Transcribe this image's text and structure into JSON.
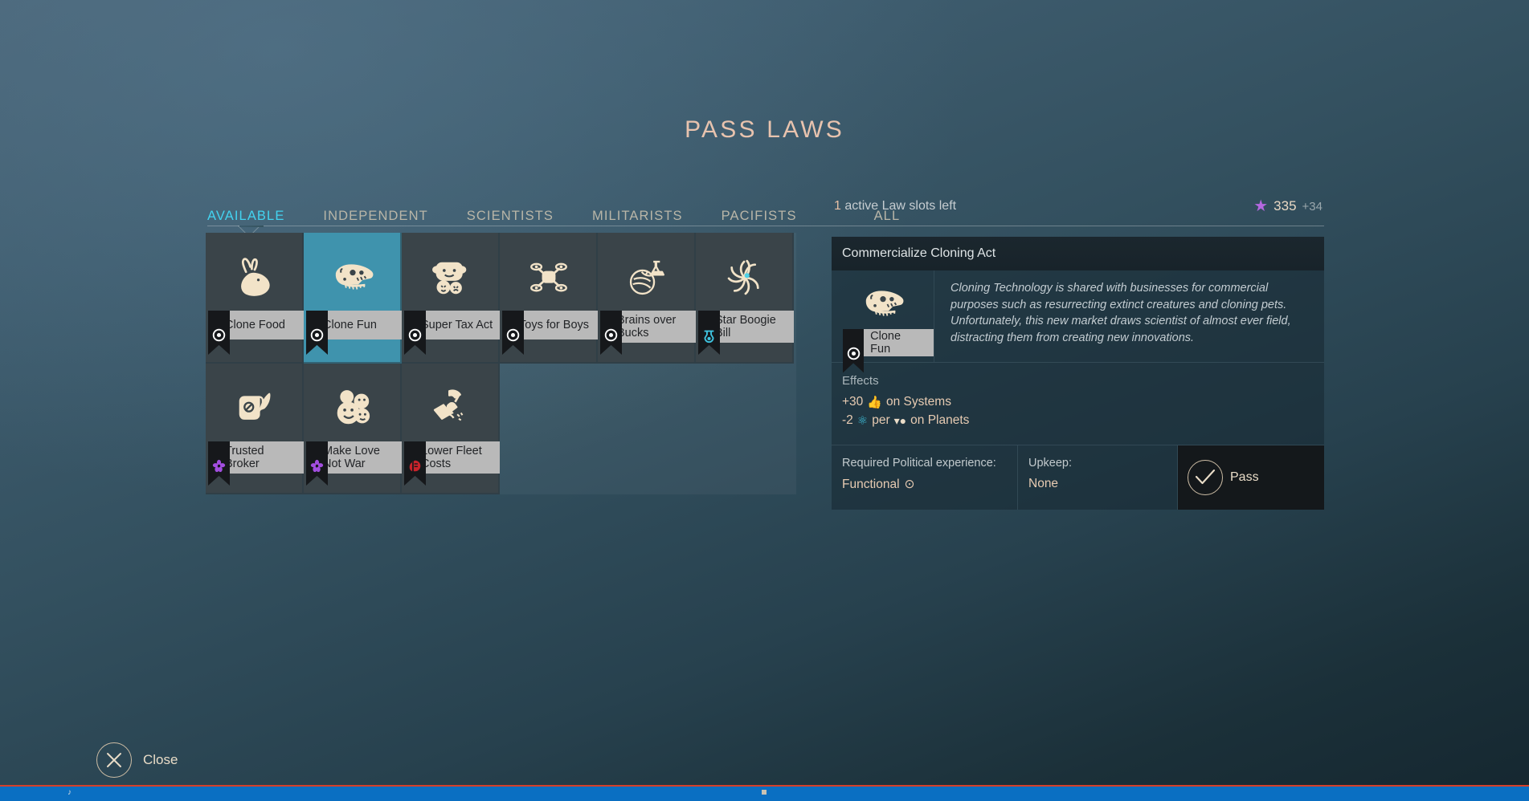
{
  "page_title": "PASS LAWS",
  "tabs": [
    {
      "label": "AVAILABLE",
      "active": true
    },
    {
      "label": "INDEPENDENT",
      "active": false
    },
    {
      "label": "SCIENTISTS",
      "active": false
    },
    {
      "label": "MILITARISTS",
      "active": false
    },
    {
      "label": "PACIFISTS",
      "active": false
    },
    {
      "label": "ALL",
      "active": false,
      "spaced": true
    }
  ],
  "status": {
    "slots_count": "1",
    "slots_text": " active Law slots left",
    "currency_icon": "star-icon",
    "currency_value": "335",
    "currency_delta": "+34",
    "currency_color": "#b468e0"
  },
  "cards": [
    {
      "name": "Clone Food",
      "icon": "rabbit-icon",
      "badge": "eye-badge",
      "badge_color": "#ffffff",
      "selected": false
    },
    {
      "name": "Clone Fun",
      "icon": "dino-skull-icon",
      "badge": "eye-badge",
      "badge_color": "#ffffff",
      "selected": true
    },
    {
      "name": "Super Tax Act",
      "icon": "masks-icon",
      "badge": "eye-badge",
      "badge_color": "#ffffff",
      "selected": false
    },
    {
      "name": "Toys for Boys",
      "icon": "drone-icon",
      "badge": "eye-badge",
      "badge_color": "#ffffff",
      "selected": false
    },
    {
      "name": "Brains over Bucks",
      "icon": "flask-orbit-icon",
      "badge": "eye-badge",
      "badge_color": "#ffffff",
      "selected": false
    },
    {
      "name": "Star Boogie Bill",
      "icon": "spiral-icon",
      "badge": "potion-badge",
      "badge_color": "#3fc4e0",
      "selected": false
    },
    {
      "name": "Trusted Broker",
      "icon": "scroll-quill-icon",
      "badge": "flower-badge",
      "badge_color": "#a34ee0",
      "selected": false
    },
    {
      "name": "Make Love Not War",
      "icon": "smileys-icon",
      "badge": "flower-badge",
      "badge_color": "#a34ee0",
      "selected": false
    },
    {
      "name": "Lower Fleet Costs",
      "icon": "hammer-hand-icon",
      "badge": "helmet-badge",
      "badge_color": "#c8232b",
      "selected": false
    }
  ],
  "detail": {
    "title": "Commercialize Cloning Act",
    "icon": "dino-skull-icon",
    "chip_label": "Clone Fun",
    "chip_badge": "eye-badge",
    "description": "Cloning Technology is shared with businesses for commercial purposes such as resurrecting extinct creatures and cloning pets. Unfortunately, this new market draws scientist of almost ever field, distracting them from creating new innovations.",
    "effects_title": "Effects",
    "effects": [
      {
        "amount": "+30",
        "icon": "approval-thumb-icon",
        "icon_color": "#f06cc0",
        "text": "on Systems"
      },
      {
        "amount": "-2",
        "icon": "research-atom-icon",
        "icon_color": "#3fc4e0",
        "text_pre": "per",
        "icon2": "population-icon",
        "icon2_color": "#eadcc8",
        "text": "on Planets"
      }
    ],
    "requirement_label": "Required Political experience:",
    "requirement_value": "Functional",
    "requirement_icon": "eye-icon",
    "upkeep_label": "Upkeep:",
    "upkeep_value": "None",
    "pass_label": "Pass",
    "pass_icon": "checkmark-icon"
  },
  "close": {
    "label": "Close",
    "icon": "close-x-icon"
  }
}
